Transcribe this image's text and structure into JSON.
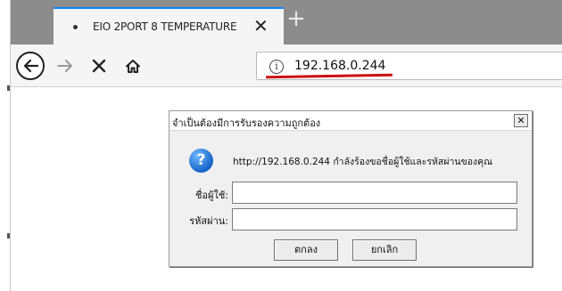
{
  "browser": {
    "tab": {
      "title": "EIO 2PORT 8 TEMPERATURE",
      "close_glyph": "✕"
    },
    "new_tab_glyph": "+",
    "nav": {
      "back_icon": "back-arrow-icon",
      "forward_icon": "forward-arrow-icon",
      "stop_icon": "stop-icon",
      "home_icon": "home-icon"
    },
    "url": "192.168.0.244",
    "annotation_color": "#cc1111"
  },
  "dialog": {
    "title": "จำเป็นต้องมีการรับรองความถูกต้อง",
    "close_glyph": "✕",
    "message": "http://192.168.0.244 กำลังร้องขอชื่อผู้ใช้และรหัสผ่านของคุณ",
    "username_label": "ชื่อผู้ใช้:",
    "username_value": "",
    "password_label": "รหัสผ่าน:",
    "password_value": "",
    "ok_label": "ตกลง",
    "cancel_label": "ยกเลิก"
  }
}
